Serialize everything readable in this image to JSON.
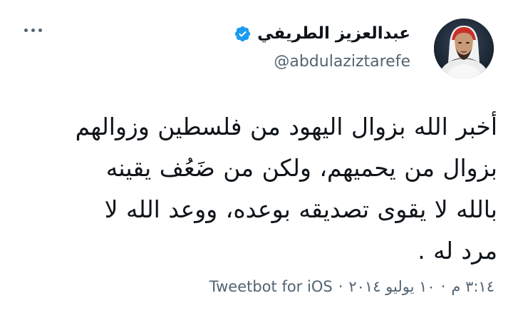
{
  "tweet": {
    "author": {
      "display_name": "عبدالعزيز الطريفي",
      "handle": "@abdulaziztarefe",
      "verified": true
    },
    "more_icon": "more-horizontal-icon",
    "verified_icon": "verified-badge-icon",
    "text": "أخبر الله بزوال اليهود من فلسطين وزوالهم\nبزوال من يحميهم، ولكن من ضَعُف يقينه\nبالله لا يقوى تصديقه بوعده، ووعد الله لا\nمرد له .",
    "meta": {
      "time": "٣:١٤ م",
      "separator": "·",
      "date": "١٠ يوليو ٢٠١٤",
      "source": "Tweetbot for iOS"
    },
    "colors": {
      "text": "#0f1419",
      "secondary": "#536471",
      "verified": "#1d9bf0"
    }
  }
}
